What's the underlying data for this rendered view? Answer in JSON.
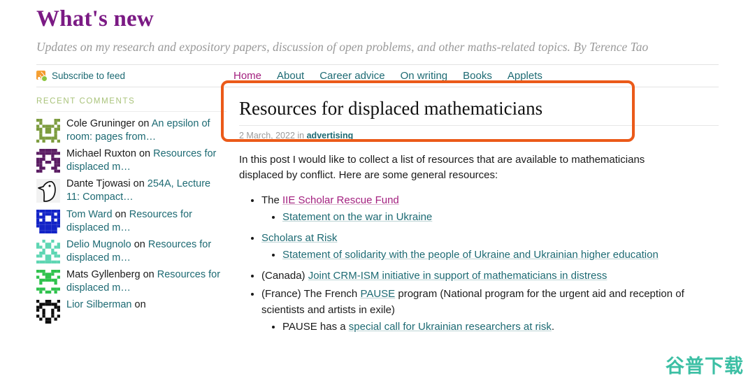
{
  "site": {
    "title": "What's new",
    "tagline": "Updates on my research and expository papers, discussion of open problems, and other maths-related topics. By Terence Tao",
    "title_color": "#7b1a84"
  },
  "nav_strip": {
    "subscribe_label": "Subscribe to feed",
    "subscribe_icon": "rss-icon",
    "items": [
      {
        "label": "Home",
        "current": true
      },
      {
        "label": "About",
        "current": false
      },
      {
        "label": "Career advice",
        "current": false
      },
      {
        "label": "On writing",
        "current": false
      },
      {
        "label": "Books",
        "current": false
      },
      {
        "label": "Applets",
        "current": false
      }
    ]
  },
  "sidebar": {
    "heading": "RECENT COMMENTS",
    "comments": [
      {
        "author": "Cole Gruninger",
        "author_is_link": false,
        "on": " on ",
        "post": "An epsilon of room: pages from…",
        "avatar": "identicon-olive"
      },
      {
        "author": "Michael Ruxton",
        "author_is_link": false,
        "on": " on ",
        "post": "Resources for displaced m…",
        "avatar": "identicon-purple"
      },
      {
        "author": "Dante Tjowasi",
        "author_is_link": false,
        "on": " on ",
        "post": "254A, Lecture 11: Compact…",
        "avatar": "bird-avatar"
      },
      {
        "author": "Tom Ward",
        "author_is_link": true,
        "on": " on ",
        "post": "Resources for displaced m…",
        "avatar": "identicon-blue"
      },
      {
        "author": "Delio Mugnolo",
        "author_is_link": true,
        "on": " on ",
        "post": "Resources for displaced m…",
        "avatar": "identicon-mint"
      },
      {
        "author": "Mats Gyllenberg",
        "author_is_link": false,
        "on": " on ",
        "post": "Resources for displaced m…",
        "avatar": "identicon-green"
      },
      {
        "author": "Lior Silberman",
        "author_is_link": true,
        "on": " on ",
        "post": "",
        "avatar": "identicon-black"
      }
    ]
  },
  "post": {
    "title": "Resources for displaced mathematicians",
    "date": "2 March, 2022",
    "in_word": " in ",
    "category": "advertising",
    "highlight_color": "#eb5a19",
    "intro": "In this post I would like to collect a list of resources that are available to mathematicians displaced by conflict. Here are some general resources:",
    "items": [
      {
        "prefix": "The ",
        "link": "IIE Scholar Rescue Fund",
        "link_style": "purple",
        "suffix": "",
        "sub": [
          {
            "prefix": "",
            "link": "Statement on the war in Ukraine",
            "link_style": "teal",
            "suffix": ""
          }
        ]
      },
      {
        "prefix": "",
        "link": "Scholars at Risk",
        "link_style": "teal",
        "suffix": "",
        "sub": [
          {
            "prefix": "",
            "link": "Statement of solidarity with the people of Ukraine and Ukrainian higher education",
            "link_style": "teal",
            "suffix": ""
          }
        ]
      },
      {
        "prefix": "(Canada) ",
        "link": "Joint CRM-ISM initiative in support of mathematicians in distress",
        "link_style": "teal",
        "suffix": "",
        "sub": []
      },
      {
        "prefix": "(France) The French ",
        "link": "PAUSE",
        "link_style": "teal",
        "suffix": " program (National program for the urgent aid and reception of scientists and artists in exile)",
        "sub": [
          {
            "prefix": "PAUSE has a ",
            "link": "special call for Ukrainian researchers at risk",
            "link_style": "teal",
            "suffix": "."
          }
        ]
      }
    ]
  },
  "watermark": {
    "text": "谷普下载",
    "color": "#3cbfa4"
  }
}
